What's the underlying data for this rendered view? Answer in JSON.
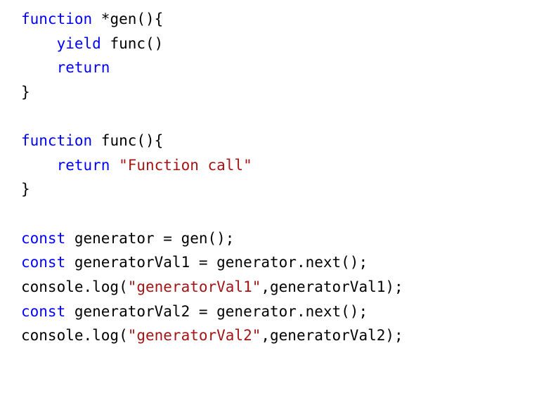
{
  "code": {
    "tokens": [
      [
        {
          "t": "function",
          "c": "kw"
        },
        {
          "t": " *gen(){",
          "c": "plain"
        }
      ],
      [
        {
          "t": "    ",
          "c": "plain"
        },
        {
          "t": "yield",
          "c": "kw"
        },
        {
          "t": " func()",
          "c": "plain"
        }
      ],
      [
        {
          "t": "    ",
          "c": "plain"
        },
        {
          "t": "return",
          "c": "kw"
        }
      ],
      [
        {
          "t": "}",
          "c": "plain"
        }
      ],
      [
        {
          "t": "",
          "c": "plain"
        }
      ],
      [
        {
          "t": "function",
          "c": "kw"
        },
        {
          "t": " func(){",
          "c": "plain"
        }
      ],
      [
        {
          "t": "    ",
          "c": "plain"
        },
        {
          "t": "return",
          "c": "kw"
        },
        {
          "t": " ",
          "c": "plain"
        },
        {
          "t": "\"Function call\"",
          "c": "str"
        }
      ],
      [
        {
          "t": "}",
          "c": "plain"
        }
      ],
      [
        {
          "t": "",
          "c": "plain"
        }
      ],
      [
        {
          "t": "const",
          "c": "kw"
        },
        {
          "t": " generator = gen();",
          "c": "plain"
        }
      ],
      [
        {
          "t": "const",
          "c": "kw"
        },
        {
          "t": " generatorVal1 = generator.next();",
          "c": "plain"
        }
      ],
      [
        {
          "t": "console.log(",
          "c": "plain"
        },
        {
          "t": "\"generatorVal1\"",
          "c": "str"
        },
        {
          "t": ",generatorVal1);",
          "c": "plain"
        }
      ],
      [
        {
          "t": "const",
          "c": "kw"
        },
        {
          "t": " generatorVal2 = generator.next();",
          "c": "plain"
        }
      ],
      [
        {
          "t": "console.log(",
          "c": "plain"
        },
        {
          "t": "\"generatorVal2\"",
          "c": "str"
        },
        {
          "t": ",generatorVal2);",
          "c": "plain"
        }
      ]
    ]
  }
}
